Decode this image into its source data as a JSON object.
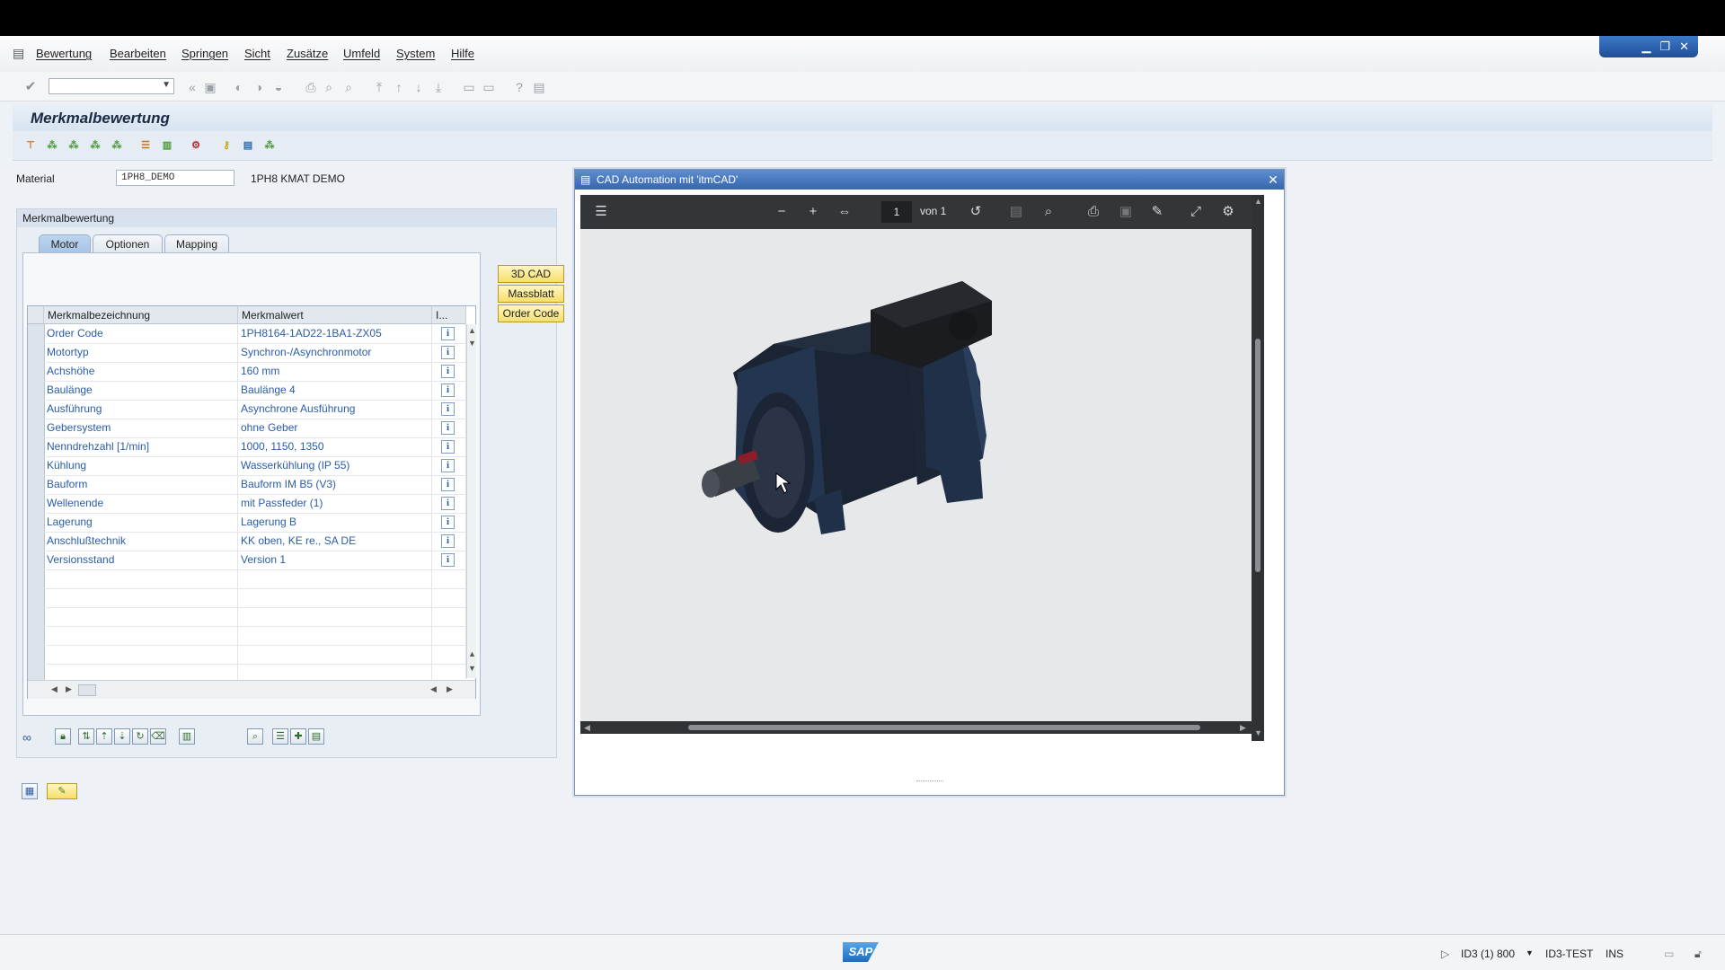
{
  "menubar": {
    "items": [
      "Bewertung",
      "Bearbeiten",
      "Springen",
      "Sicht",
      "Zusätze",
      "Umfeld",
      "System",
      "Hilfe"
    ]
  },
  "screen": {
    "title": "Merkmalbewertung",
    "material_label": "Material",
    "material_value": "1PH8_DEMO",
    "material_desc": "1PH8 KMAT DEMO"
  },
  "panel": {
    "title": "Merkmalbewertung",
    "tabs": [
      {
        "label": "Motor",
        "active": true
      },
      {
        "label": "Optionen",
        "active": false
      },
      {
        "label": "Mapping",
        "active": false
      }
    ],
    "buttons": [
      "3D CAD",
      "Massblatt",
      "Order Code"
    ],
    "grid": {
      "columns": [
        "Merkmalbezeichnung",
        "Merkmalwert",
        "I..."
      ],
      "rows": [
        {
          "name": "Order Code",
          "value": "1PH8164-1AD22-1BA1-ZX05"
        },
        {
          "name": "Motortyp",
          "value": "Synchron-/Asynchronmotor"
        },
        {
          "name": "Achshöhe",
          "value": "160 mm"
        },
        {
          "name": "Baulänge",
          "value": "Baulänge 4"
        },
        {
          "name": "Ausführung",
          "value": "Asynchrone Ausführung"
        },
        {
          "name": "Gebersystem",
          "value": "ohne Geber"
        },
        {
          "name": "Nenndrehzahl [1/min]",
          "value": "1000, 1150, 1350"
        },
        {
          "name": "Kühlung",
          "value": "Wasserkühlung (IP 55)"
        },
        {
          "name": "Bauform",
          "value": "Bauform IM B5 (V3)"
        },
        {
          "name": "Wellenende",
          "value": "mit Passfeder (1)"
        },
        {
          "name": "Lagerung",
          "value": "Lagerung B"
        },
        {
          "name": "Anschlußtechnik",
          "value": "KK oben, KE re., SA DE"
        },
        {
          "name": "Versionsstand",
          "value": "Version 1"
        }
      ]
    }
  },
  "cad_window": {
    "title": "CAD Automation mit 'itmCAD'",
    "page_current": "1",
    "page_total_label": "von 1"
  },
  "statusbar": {
    "sap_logo": "SAP",
    "session": "ID3 (1) 800",
    "system": "ID3-TEST",
    "mode": "INS"
  },
  "colors": {
    "accent": "#3565ad",
    "link_text": "#2a5ca8",
    "button_yellow": "#f6df6a",
    "pdf_toolbar": "#323639"
  }
}
